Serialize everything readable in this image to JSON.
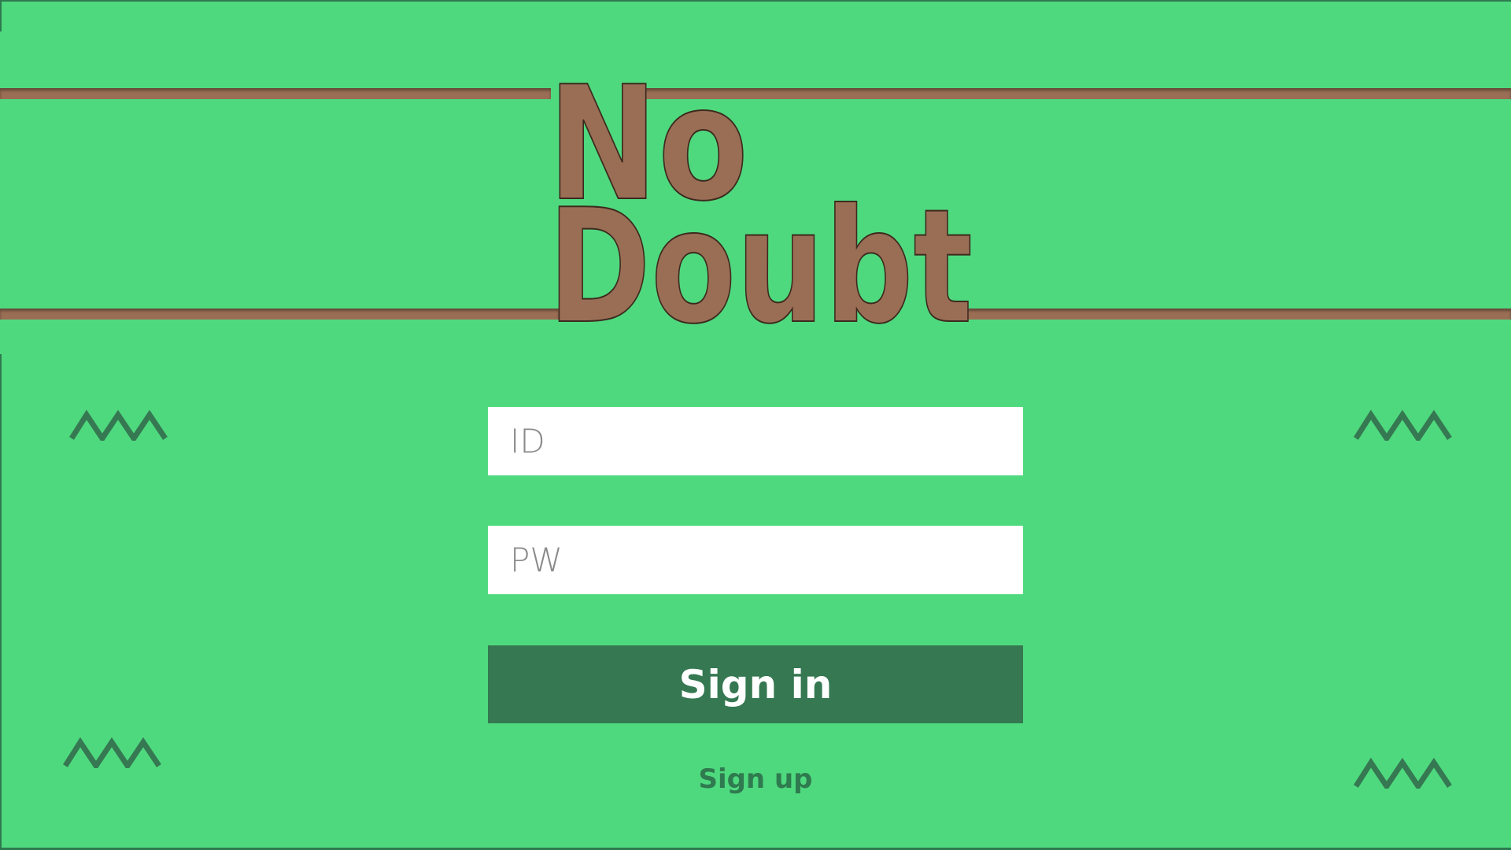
{
  "brand": {
    "line1": "No",
    "line2": "Doubt"
  },
  "login": {
    "id_placeholder": "ID",
    "pw_placeholder": "PW",
    "signin_label": "Sign in",
    "signup_label": "Sign up"
  },
  "colors": {
    "background": "#4fd97e",
    "band": "#9a6e55",
    "button": "#357852",
    "accent": "#2f7a4f"
  },
  "decor": {
    "zigzag_icon": "zigzag-icon"
  }
}
